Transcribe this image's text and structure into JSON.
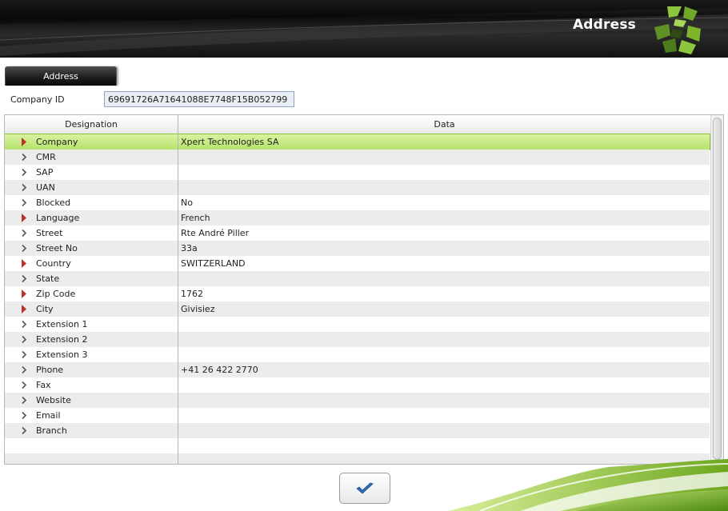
{
  "header": {
    "title": "Address"
  },
  "tabs": [
    {
      "label": "Address",
      "active": true
    }
  ],
  "company_id": {
    "label": "Company ID",
    "value": "69691726A71641088E7748F15B052799"
  },
  "table": {
    "columns": [
      "Designation",
      "Data"
    ],
    "rows": [
      {
        "name": "Company",
        "value": "Xpert Technologies SA",
        "required": true,
        "selected": true
      },
      {
        "name": "CMR",
        "value": "",
        "required": false
      },
      {
        "name": "SAP",
        "value": "",
        "required": false
      },
      {
        "name": "UAN",
        "value": "",
        "required": false
      },
      {
        "name": "Blocked",
        "value": "No",
        "required": false
      },
      {
        "name": "Language",
        "value": "French",
        "required": true
      },
      {
        "name": "Street",
        "value": "Rte André Piller",
        "required": false
      },
      {
        "name": "Street No",
        "value": "33a",
        "required": false
      },
      {
        "name": "Country",
        "value": "SWITZERLAND",
        "required": true
      },
      {
        "name": "State",
        "value": "",
        "required": false
      },
      {
        "name": "Zip Code",
        "value": "1762",
        "required": true
      },
      {
        "name": "City",
        "value": "Givisiez",
        "required": true
      },
      {
        "name": "Extension 1",
        "value": "",
        "required": false
      },
      {
        "name": "Extension 2",
        "value": "",
        "required": false
      },
      {
        "name": "Extension 3",
        "value": "",
        "required": false
      },
      {
        "name": "Phone",
        "value": "+41 26 422 2770",
        "required": false
      },
      {
        "name": "Fax",
        "value": "",
        "required": false
      },
      {
        "name": "Website",
        "value": "",
        "required": false
      },
      {
        "name": "Email",
        "value": "",
        "required": false
      },
      {
        "name": "Branch",
        "value": "",
        "required": false
      }
    ]
  },
  "icons": {
    "logo": "brand-logo-icon",
    "row_required": "red-triangle-icon",
    "row_optional": "chevron-right-icon",
    "ok": "checkmark-icon"
  },
  "colors": {
    "header_bg": "#111111",
    "selected_row": "#c4ea82",
    "required_marker": "#c0302a",
    "logo_green": "#7fb52a",
    "checkmark_blue": "#2f6fb8"
  }
}
